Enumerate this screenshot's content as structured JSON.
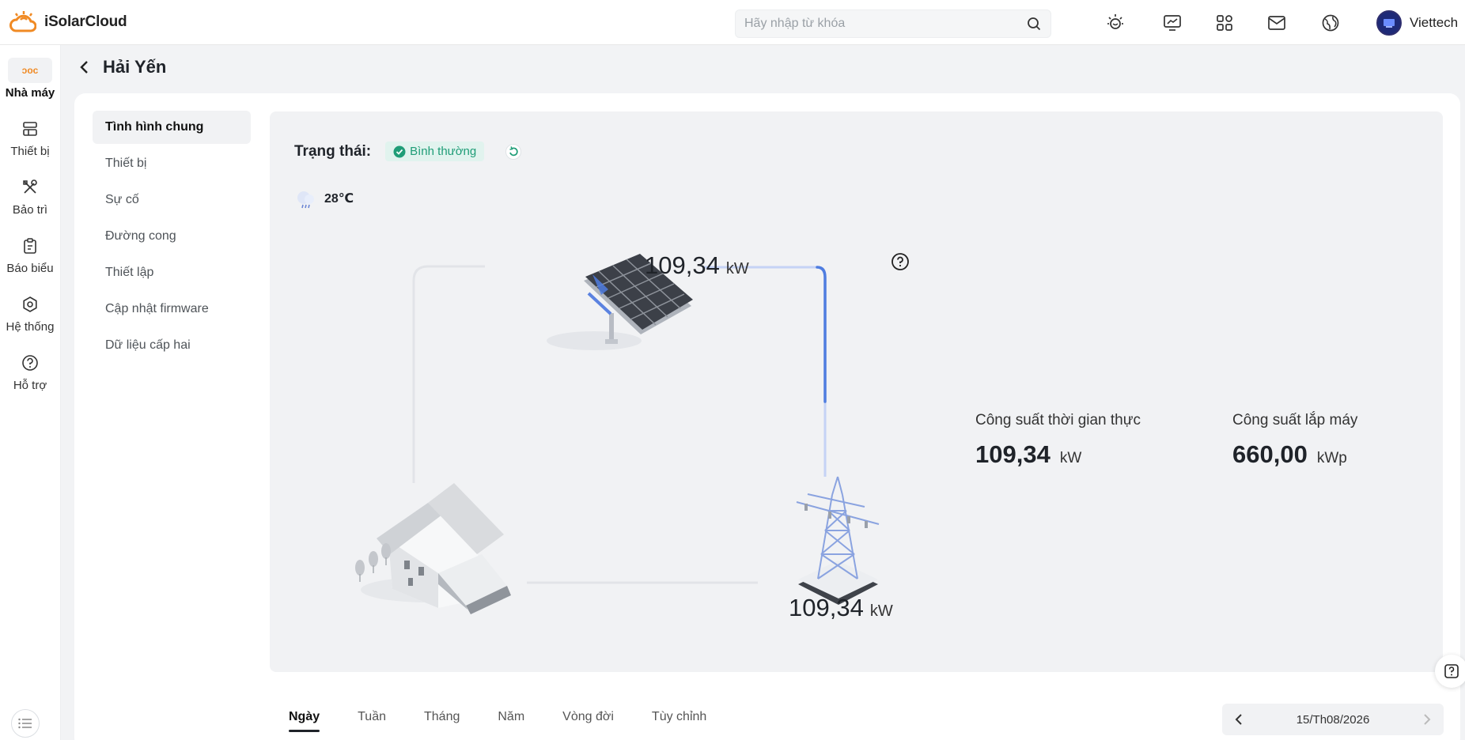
{
  "app": {
    "name": "iSolarCloud"
  },
  "header": {
    "search_placeholder": "Hãy nhập từ khóa",
    "icons": [
      "sun-icon",
      "monitor-chart-icon",
      "apps-grid-icon",
      "mail-icon",
      "globe-icon"
    ],
    "user_name": "Viettech"
  },
  "leftnav": {
    "items": [
      {
        "label": "Nhà máy",
        "icon": "plant-icon",
        "active": true
      },
      {
        "label": "Thiết bị",
        "icon": "device-icon"
      },
      {
        "label": "Bảo trì",
        "icon": "tools-icon"
      },
      {
        "label": "Báo biểu",
        "icon": "report-icon"
      },
      {
        "label": "Hệ thống",
        "icon": "gear-icon"
      },
      {
        "label": "Hỗ trợ",
        "icon": "help-icon"
      }
    ]
  },
  "page": {
    "title": "Hải Yến"
  },
  "submenu": {
    "items": [
      {
        "label": "Tình hình chung",
        "active": true
      },
      {
        "label": "Thiết bị"
      },
      {
        "label": "Sự cố"
      },
      {
        "label": "Đường cong"
      },
      {
        "label": "Thiết lập"
      },
      {
        "label": "Cập nhật firmware"
      },
      {
        "label": "Dữ liệu cấp hai"
      }
    ]
  },
  "overview": {
    "status_label": "Trạng thái:",
    "status_value": "Bình thường",
    "status_color": "#1f9d77",
    "temperature": "28℃",
    "pv_power": {
      "value": "109,34",
      "unit": "kW"
    },
    "grid_power": {
      "value": "109,34",
      "unit": "kW"
    },
    "realtime": {
      "label": "Công suất thời gian thực",
      "value": "109,34",
      "unit": "kW"
    },
    "installed": {
      "label": "Công suất lắp máy",
      "value": "660,00",
      "unit": "kWp"
    },
    "flow_color": "#4f7de0"
  },
  "period": {
    "tabs": [
      "Ngày",
      "Tuần",
      "Tháng",
      "Năm",
      "Vòng đời",
      "Tùy chỉnh"
    ],
    "active": "Ngày",
    "date": "15/Th08/2026"
  },
  "accent_color": "#f08a24"
}
